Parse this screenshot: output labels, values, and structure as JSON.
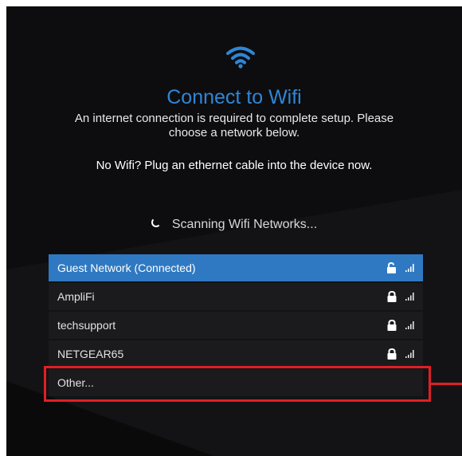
{
  "header": {
    "wifi_icon": "wifi-icon",
    "title": "Connect to Wifi",
    "subtitle": "An internet connection is required to complete setup. Please choose a network below.",
    "ethernet_note": "No Wifi? Plug an ethernet cable into the device now."
  },
  "scanning": {
    "spinner_icon": "spinner-icon",
    "text": "Scanning Wifi Networks..."
  },
  "networks": [
    {
      "label": "Guest Network (Connected)",
      "lock": "unlocked-icon",
      "signal": "signal-icon",
      "connected": true
    },
    {
      "label": "AmpliFi",
      "lock": "lock-icon",
      "signal": "signal-icon",
      "connected": false
    },
    {
      "label": "techsupport",
      "lock": "lock-icon",
      "signal": "signal-icon",
      "connected": false
    },
    {
      "label": "NETGEAR65",
      "lock": "lock-icon",
      "signal": "signal-icon",
      "connected": false
    },
    {
      "label": "Other...",
      "connected": false
    }
  ],
  "colors": {
    "background": "#0d0d0f",
    "accent": "#2f86d6",
    "connected_row": "#2f79c2",
    "row": "#1b1b1d",
    "highlight": "#e01f26"
  }
}
